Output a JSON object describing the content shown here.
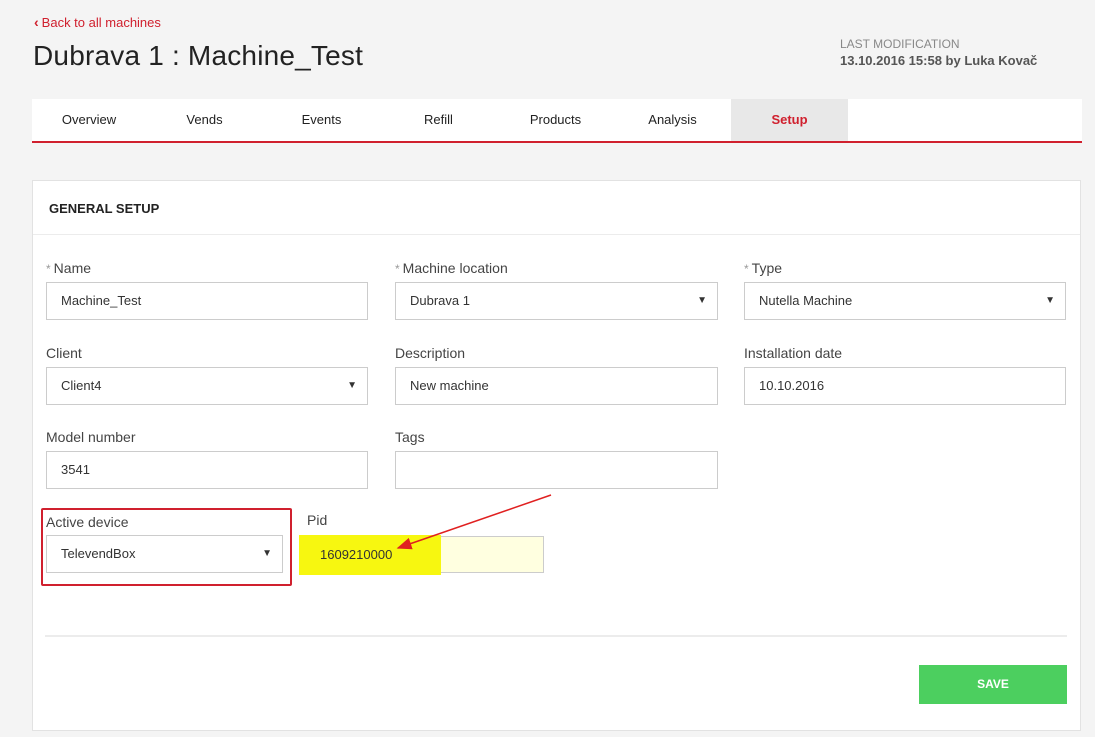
{
  "header": {
    "back_link": "Back to all machines",
    "title": "Dubrava 1 : Machine_Test",
    "last_modification_label": "LAST MODIFICATION",
    "last_modification_value": "13.10.2016 15:58 by Luka Kovač"
  },
  "tabs": [
    {
      "label": "Overview"
    },
    {
      "label": "Vends"
    },
    {
      "label": "Events"
    },
    {
      "label": "Refill"
    },
    {
      "label": "Products"
    },
    {
      "label": "Analysis"
    },
    {
      "label": "Setup",
      "active": true
    }
  ],
  "general_setup": {
    "title": "GENERAL SETUP",
    "required_mark": "*",
    "name": {
      "label": "Name",
      "value": "Machine_Test"
    },
    "machine_location": {
      "label": "Machine location",
      "value": "Dubrava 1"
    },
    "type": {
      "label": "Type",
      "value": "Nutella Machine"
    },
    "client": {
      "label": "Client",
      "value": "Client4"
    },
    "description": {
      "label": "Description",
      "value": "New machine"
    },
    "installation_date": {
      "label": "Installation date",
      "value": "10.10.2016"
    },
    "model_number": {
      "label": "Model number",
      "value": "3541"
    },
    "tags": {
      "label": "Tags",
      "value": ""
    },
    "active_device": {
      "label": "Active device",
      "value": "TelevendBox"
    },
    "pid": {
      "label": "Pid",
      "value": "1609210000"
    },
    "save_label": "SAVE"
  },
  "colors": {
    "accent": "#d0202e",
    "save": "#4ccf5f",
    "highlight": "#f7f710"
  },
  "icons": {
    "back": "chevron-left-icon",
    "dropdown": "caret-down-icon",
    "annotation": "arrow-icon"
  }
}
